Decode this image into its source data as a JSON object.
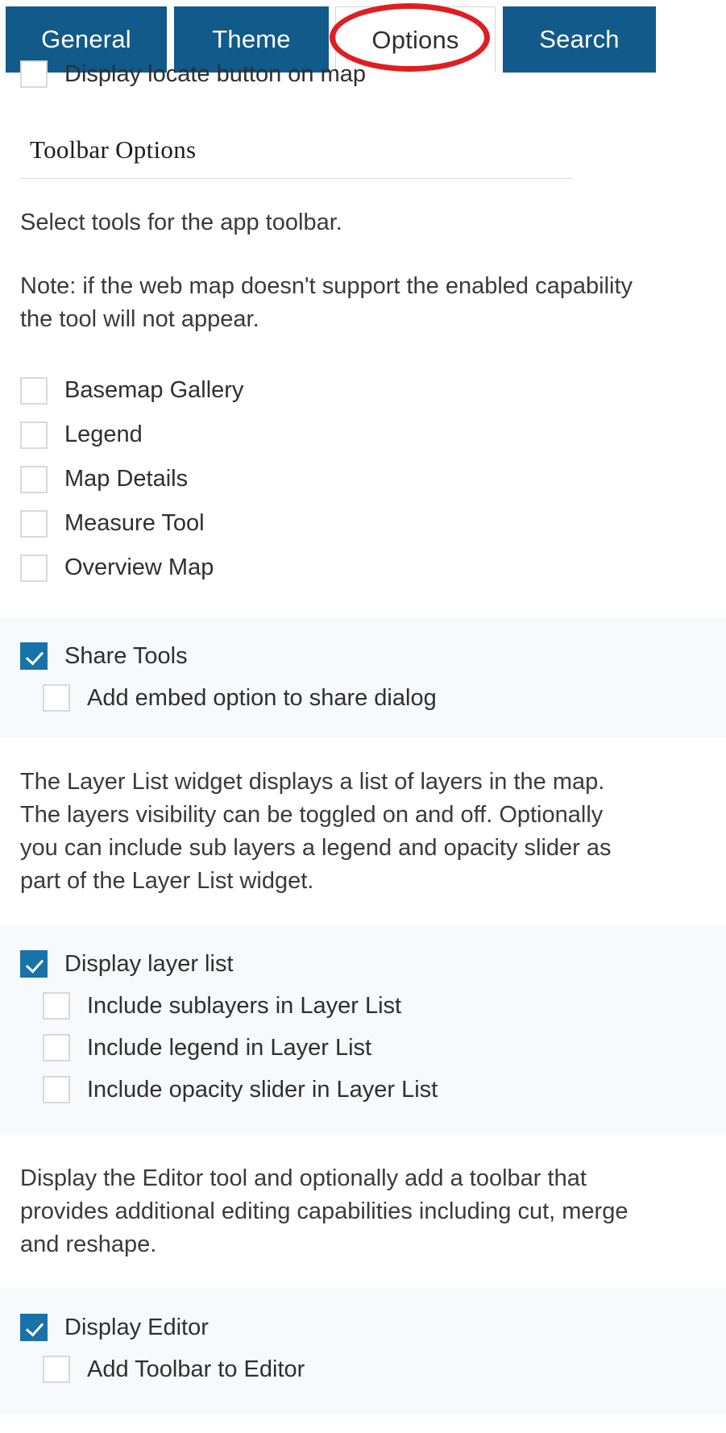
{
  "tabs": [
    {
      "label": "General",
      "active": false
    },
    {
      "label": "Theme",
      "active": false
    },
    {
      "label": "Options",
      "active": true
    },
    {
      "label": "Search",
      "active": false
    }
  ],
  "annotation": {
    "shape": "red-ellipse",
    "target": "Options",
    "color": "#e01e22"
  },
  "clipped_row": {
    "label": "Display locate button on map",
    "checked": false
  },
  "section": {
    "heading": "Toolbar Options",
    "intro": "Select tools for the app toolbar.",
    "note": "Note: if the web map doesn't support the enabled capability the tool will not appear."
  },
  "tool_checkboxes": [
    {
      "label": "Basemap Gallery",
      "checked": false
    },
    {
      "label": "Legend",
      "checked": false
    },
    {
      "label": "Map Details",
      "checked": false
    },
    {
      "label": "Measure Tool",
      "checked": false
    },
    {
      "label": "Overview Map",
      "checked": false
    }
  ],
  "share_group": {
    "parent": {
      "label": "Share Tools",
      "checked": true
    },
    "children": [
      {
        "label": "Add embed option to share dialog",
        "checked": false
      }
    ]
  },
  "layerlist_description": "The Layer List widget displays a list of layers in the map. The layers visibility can be toggled on and off. Optionally you can include sub layers a legend and opacity slider as part of the Layer List widget.",
  "layerlist_group": {
    "parent": {
      "label": "Display layer list",
      "checked": true
    },
    "children": [
      {
        "label": "Include sublayers in Layer List",
        "checked": false
      },
      {
        "label": "Include legend in Layer List",
        "checked": false
      },
      {
        "label": "Include opacity slider in Layer List",
        "checked": false
      }
    ]
  },
  "editor_description": "Display the Editor tool and optionally add a toolbar that provides additional editing capabilities including cut, merge and reshape.",
  "editor_group": {
    "parent": {
      "label": "Display Editor",
      "checked": true
    },
    "children": [
      {
        "label": "Add Toolbar to Editor",
        "checked": false
      }
    ]
  },
  "colors": {
    "tab_blue": "#115a8a",
    "checkbox_blue": "#1873a8",
    "group_background": "#f7fafd",
    "annotation_red": "#e01e22",
    "text": "#2f2f2f"
  }
}
